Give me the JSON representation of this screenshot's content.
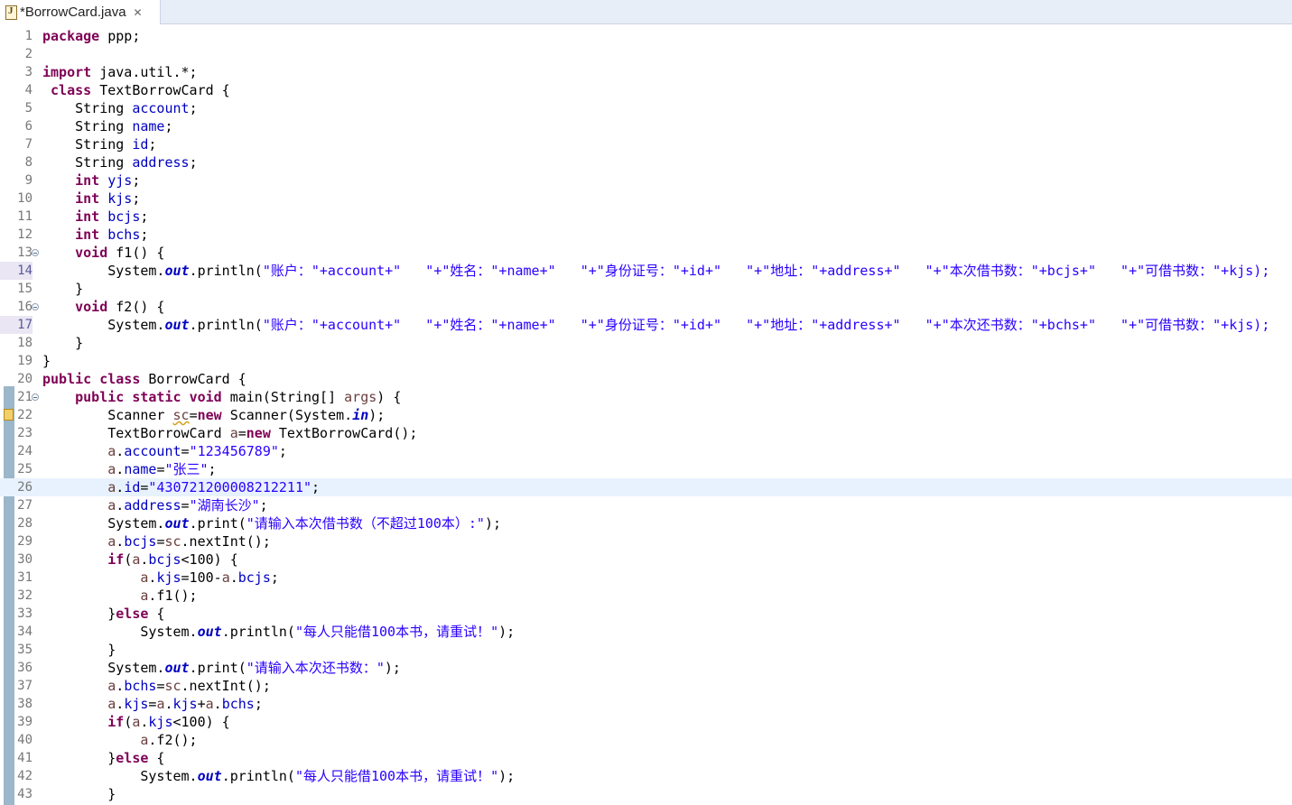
{
  "tab": {
    "title": "*BorrowCard.java",
    "icon": "java-file-icon",
    "close_icon": "close-icon"
  },
  "editor": {
    "current_line": 26,
    "lines": [
      {
        "n": "1",
        "tokens": [
          [
            "kw",
            "package"
          ],
          [
            "",
            " ppp;"
          ]
        ]
      },
      {
        "n": "2",
        "tokens": []
      },
      {
        "n": "3",
        "tokens": [
          [
            "kw",
            "import"
          ],
          [
            "",
            " java.util.*;"
          ]
        ]
      },
      {
        "n": "4",
        "tokens": [
          [
            "",
            " "
          ],
          [
            "kw",
            "class"
          ],
          [
            "",
            " TextBorrowCard {"
          ]
        ]
      },
      {
        "n": "5",
        "tokens": [
          [
            "",
            "    String "
          ],
          [
            "fld",
            "account"
          ],
          [
            "",
            ";"
          ]
        ]
      },
      {
        "n": "6",
        "tokens": [
          [
            "",
            "    String "
          ],
          [
            "fld",
            "name"
          ],
          [
            "",
            ";"
          ]
        ]
      },
      {
        "n": "7",
        "tokens": [
          [
            "",
            "    String "
          ],
          [
            "fld",
            "id"
          ],
          [
            "",
            ";"
          ]
        ]
      },
      {
        "n": "8",
        "tokens": [
          [
            "",
            "    String "
          ],
          [
            "fld",
            "address"
          ],
          [
            "",
            ";"
          ]
        ]
      },
      {
        "n": "9",
        "tokens": [
          [
            "",
            "    "
          ],
          [
            "kw",
            "int"
          ],
          [
            "",
            " "
          ],
          [
            "fld",
            "yjs"
          ],
          [
            "",
            ";"
          ]
        ]
      },
      {
        "n": "10",
        "tokens": [
          [
            "",
            "    "
          ],
          [
            "kw",
            "int"
          ],
          [
            "",
            " "
          ],
          [
            "fld",
            "kjs"
          ],
          [
            "",
            ";"
          ]
        ]
      },
      {
        "n": "11",
        "tokens": [
          [
            "",
            "    "
          ],
          [
            "kw",
            "int"
          ],
          [
            "",
            " "
          ],
          [
            "fld",
            "bcjs"
          ],
          [
            "",
            ";"
          ]
        ]
      },
      {
        "n": "12",
        "tokens": [
          [
            "",
            "    "
          ],
          [
            "kw",
            "int"
          ],
          [
            "",
            " "
          ],
          [
            "fld",
            "bchs"
          ],
          [
            "",
            ";"
          ]
        ]
      },
      {
        "n": "13",
        "fold": true,
        "tokens": [
          [
            "",
            "    "
          ],
          [
            "kw",
            "void"
          ],
          [
            "",
            " f1() {"
          ]
        ]
      },
      {
        "n": "14",
        "hl": true,
        "tokens": [
          [
            "",
            "        System."
          ],
          [
            "sfld",
            "out"
          ],
          [
            "",
            ".println("
          ],
          [
            "str",
            "\"账户：\"+account+\"   \"+\"姓名：\"+name+\"   \"+\"身份证号：\"+id+\"   \"+\"地址：\"+address+\"   \"+\"本次借书数：\"+bcjs+\"   \"+\"可借书数：\"+kjs);"
          ]
        ]
      },
      {
        "n": "15",
        "tokens": [
          [
            "",
            "    }"
          ]
        ]
      },
      {
        "n": "16",
        "fold": true,
        "tokens": [
          [
            "",
            "    "
          ],
          [
            "kw",
            "void"
          ],
          [
            "",
            " f2() {"
          ]
        ]
      },
      {
        "n": "17",
        "hl": true,
        "tokens": [
          [
            "",
            "        System."
          ],
          [
            "sfld",
            "out"
          ],
          [
            "",
            ".println("
          ],
          [
            "str",
            "\"账户：\"+account+\"   \"+\"姓名：\"+name+\"   \"+\"身份证号：\"+id+\"   \"+\"地址：\"+address+\"   \"+\"本次还书数：\"+bchs+\"   \"+\"可借书数：\"+kjs);"
          ]
        ]
      },
      {
        "n": "18",
        "tokens": [
          [
            "",
            "    }"
          ]
        ]
      },
      {
        "n": "19",
        "tokens": [
          [
            "",
            "}"
          ]
        ]
      },
      {
        "n": "20",
        "tokens": [
          [
            "kw",
            "public"
          ],
          [
            "",
            " "
          ],
          [
            "kw",
            "class"
          ],
          [
            "",
            " BorrowCard {"
          ]
        ]
      },
      {
        "n": "21",
        "fold": true,
        "tokens": [
          [
            "",
            "    "
          ],
          [
            "kw",
            "public"
          ],
          [
            "",
            " "
          ],
          [
            "kw",
            "static"
          ],
          [
            "",
            " "
          ],
          [
            "kw",
            "void"
          ],
          [
            "",
            " main(String[] "
          ],
          [
            "loc",
            "args"
          ],
          [
            "",
            ") {"
          ]
        ]
      },
      {
        "n": "22",
        "warn": true,
        "tokens": [
          [
            "",
            "        Scanner "
          ],
          [
            "unused",
            "sc"
          ],
          [
            "",
            "="
          ],
          [
            "kw",
            "new"
          ],
          [
            "",
            " Scanner(System."
          ],
          [
            "sfld",
            "in"
          ],
          [
            "",
            ");"
          ]
        ]
      },
      {
        "n": "23",
        "tokens": [
          [
            "",
            "        TextBorrowCard "
          ],
          [
            "loc",
            "a"
          ],
          [
            "",
            "="
          ],
          [
            "kw",
            "new"
          ],
          [
            "",
            " TextBorrowCard();"
          ]
        ]
      },
      {
        "n": "24",
        "tokens": [
          [
            "",
            "        "
          ],
          [
            "loc",
            "a"
          ],
          [
            "",
            "."
          ],
          [
            "fld",
            "account"
          ],
          [
            "",
            "="
          ],
          [
            "str",
            "\"123456789\""
          ],
          [
            "",
            ";"
          ]
        ]
      },
      {
        "n": "25",
        "tokens": [
          [
            "",
            "        "
          ],
          [
            "loc",
            "a"
          ],
          [
            "",
            "."
          ],
          [
            "fld",
            "name"
          ],
          [
            "",
            "="
          ],
          [
            "str",
            "\"张三\""
          ],
          [
            "",
            ";"
          ]
        ]
      },
      {
        "n": "26",
        "tokens": [
          [
            "",
            "        "
          ],
          [
            "loc",
            "a"
          ],
          [
            "",
            "."
          ],
          [
            "fld",
            "id"
          ],
          [
            "",
            "="
          ],
          [
            "str",
            "\"430721200008212211\""
          ],
          [
            "",
            ";"
          ]
        ]
      },
      {
        "n": "27",
        "tokens": [
          [
            "",
            "        "
          ],
          [
            "loc",
            "a"
          ],
          [
            "",
            "."
          ],
          [
            "fld",
            "address"
          ],
          [
            "",
            "="
          ],
          [
            "str",
            "\"湖南长沙\""
          ],
          [
            "",
            ";"
          ]
        ]
      },
      {
        "n": "28",
        "tokens": [
          [
            "",
            "        System."
          ],
          [
            "sfld",
            "out"
          ],
          [
            "",
            ".print("
          ],
          [
            "str",
            "\"请输入本次借书数（不超过100本）:\""
          ],
          [
            "",
            ");"
          ]
        ]
      },
      {
        "n": "29",
        "tokens": [
          [
            "",
            "        "
          ],
          [
            "loc",
            "a"
          ],
          [
            "",
            "."
          ],
          [
            "fld",
            "bcjs"
          ],
          [
            "",
            "="
          ],
          [
            "loc",
            "sc"
          ],
          [
            "",
            ".nextInt();"
          ]
        ]
      },
      {
        "n": "30",
        "tokens": [
          [
            "",
            "        "
          ],
          [
            "kw",
            "if"
          ],
          [
            "",
            "("
          ],
          [
            "loc",
            "a"
          ],
          [
            "",
            "."
          ],
          [
            "fld",
            "bcjs"
          ],
          [
            "",
            "<100) {"
          ]
        ]
      },
      {
        "n": "31",
        "tokens": [
          [
            "",
            "            "
          ],
          [
            "loc",
            "a"
          ],
          [
            "",
            "."
          ],
          [
            "fld",
            "kjs"
          ],
          [
            "",
            "=100-"
          ],
          [
            "loc",
            "a"
          ],
          [
            "",
            "."
          ],
          [
            "fld",
            "bcjs"
          ],
          [
            "",
            ";"
          ]
        ]
      },
      {
        "n": "32",
        "tokens": [
          [
            "",
            "            "
          ],
          [
            "loc",
            "a"
          ],
          [
            "",
            ".f1();"
          ]
        ]
      },
      {
        "n": "33",
        "tokens": [
          [
            "",
            "        }"
          ],
          [
            "kw",
            "else"
          ],
          [
            "",
            " {"
          ]
        ]
      },
      {
        "n": "34",
        "tokens": [
          [
            "",
            "            System."
          ],
          [
            "sfld",
            "out"
          ],
          [
            "",
            ".println("
          ],
          [
            "str",
            "\"每人只能借100本书，请重试！\""
          ],
          [
            "",
            ");"
          ]
        ]
      },
      {
        "n": "35",
        "tokens": [
          [
            "",
            "        }"
          ]
        ]
      },
      {
        "n": "36",
        "tokens": [
          [
            "",
            "        System."
          ],
          [
            "sfld",
            "out"
          ],
          [
            "",
            ".print("
          ],
          [
            "str",
            "\"请输入本次还书数：\""
          ],
          [
            "",
            ");"
          ]
        ]
      },
      {
        "n": "37",
        "tokens": [
          [
            "",
            "        "
          ],
          [
            "loc",
            "a"
          ],
          [
            "",
            "."
          ],
          [
            "fld",
            "bchs"
          ],
          [
            "",
            "="
          ],
          [
            "loc",
            "sc"
          ],
          [
            "",
            ".nextInt();"
          ]
        ]
      },
      {
        "n": "38",
        "tokens": [
          [
            "",
            "        "
          ],
          [
            "loc",
            "a"
          ],
          [
            "",
            "."
          ],
          [
            "fld",
            "kjs"
          ],
          [
            "",
            "="
          ],
          [
            "loc",
            "a"
          ],
          [
            "",
            "."
          ],
          [
            "fld",
            "kjs"
          ],
          [
            "",
            "+"
          ],
          [
            "loc",
            "a"
          ],
          [
            "",
            "."
          ],
          [
            "fld",
            "bchs"
          ],
          [
            "",
            ";"
          ]
        ]
      },
      {
        "n": "39",
        "tokens": [
          [
            "",
            "        "
          ],
          [
            "kw",
            "if"
          ],
          [
            "",
            "("
          ],
          [
            "loc",
            "a"
          ],
          [
            "",
            "."
          ],
          [
            "fld",
            "kjs"
          ],
          [
            "",
            "<100) {"
          ]
        ]
      },
      {
        "n": "40",
        "tokens": [
          [
            "",
            "            "
          ],
          [
            "loc",
            "a"
          ],
          [
            "",
            ".f2();"
          ]
        ]
      },
      {
        "n": "41",
        "tokens": [
          [
            "",
            "        }"
          ],
          [
            "kw",
            "else"
          ],
          [
            "",
            " {"
          ]
        ]
      },
      {
        "n": "42",
        "tokens": [
          [
            "",
            "            System."
          ],
          [
            "sfld",
            "out"
          ],
          [
            "",
            ".println("
          ],
          [
            "str",
            "\"每人只能借100本书，请重试！\""
          ],
          [
            "",
            ");"
          ]
        ]
      },
      {
        "n": "43",
        "tokens": [
          [
            "",
            "        }"
          ]
        ]
      }
    ]
  },
  "colors": {
    "keyword": "#7f0055",
    "string": "#2a00ff",
    "field": "#0000c0",
    "local": "#6a3e3e",
    "current_line": "#e8f2fe",
    "line_number": "#787878"
  }
}
